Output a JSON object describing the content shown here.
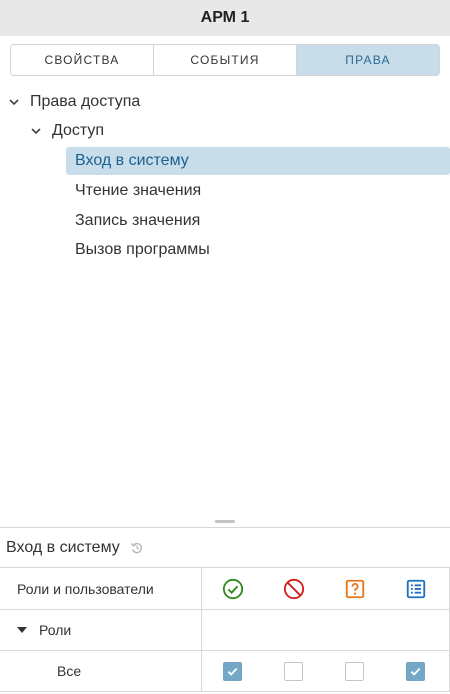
{
  "window": {
    "title": "АРМ 1"
  },
  "tabs": [
    {
      "label": "СВОЙСТВА",
      "active": false
    },
    {
      "label": "СОБЫТИЯ",
      "active": false
    },
    {
      "label": "ПРАВА",
      "active": true
    }
  ],
  "tree": {
    "root": {
      "label": "Права доступа",
      "expanded": true
    },
    "group": {
      "label": "Доступ",
      "expanded": true
    },
    "items": [
      {
        "label": "Вход в систему",
        "selected": true
      },
      {
        "label": "Чтение значения",
        "selected": false
      },
      {
        "label": "Запись значения",
        "selected": false
      },
      {
        "label": "Вызов программы",
        "selected": false
      }
    ]
  },
  "permissions": {
    "title": "Вход в систему",
    "reset_icon": "reset-icon",
    "header_label": "Роли и пользователи",
    "columns": [
      {
        "icon": "allow-icon",
        "color": "#2e8a1a"
      },
      {
        "icon": "deny-icon",
        "color": "#d11f1f"
      },
      {
        "icon": "question-icon",
        "color": "#e8751a"
      },
      {
        "icon": "list-icon",
        "color": "#1f6fc1"
      }
    ],
    "group_label": "Роли",
    "rows": [
      {
        "label": "Все",
        "checks": [
          true,
          false,
          false,
          true
        ]
      }
    ]
  },
  "colors": {
    "accent": "#c7dde9",
    "accent_text": "#1f5f8e",
    "checkbox_checked": "#74a6c6"
  }
}
